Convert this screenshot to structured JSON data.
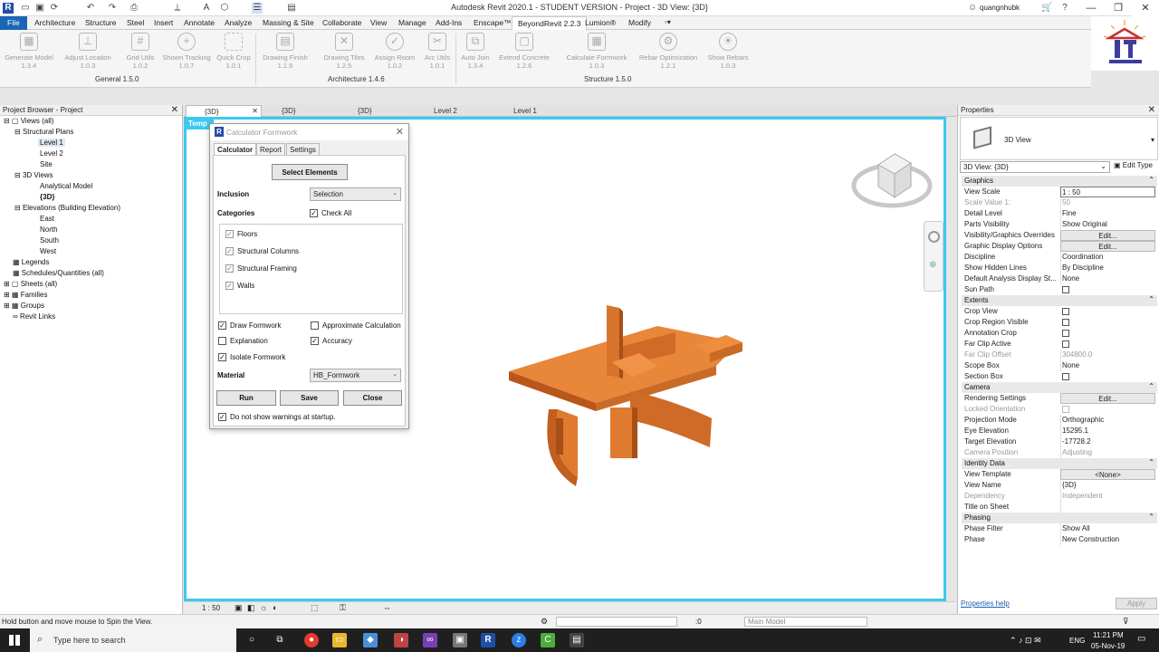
{
  "titlebar": {
    "title": "Autodesk Revit 2020.1 - STUDENT VERSION - Project - 3D View: {3D}",
    "user": "quangnhubk",
    "win_minimize": "—",
    "win_restore": "❐",
    "win_close": "✕"
  },
  "ribbon_tabs": [
    "File",
    "Architecture",
    "Structure",
    "Steel",
    "Insert",
    "Annotate",
    "Analyze",
    "Massing & Site",
    "Collaborate",
    "View",
    "Manage",
    "Add-Ins",
    "Enscape™",
    "BeyondRevit 2.2.3",
    "Lumion®",
    "Modify"
  ],
  "ribbon_tools": [
    {
      "label": "Generate Model",
      "version": "1.3.4"
    },
    {
      "label": "Adjust Location",
      "version": "1.0.3"
    },
    {
      "label": "Grid Utils",
      "version": "1.0.2"
    },
    {
      "label": "Shown Tracking",
      "version": "1.0.7"
    },
    {
      "label": "Quick Crop",
      "version": "1.0.1"
    },
    {
      "label": "Drawing Finish",
      "version": "1.1.9"
    },
    {
      "label": "Drawing Tiles",
      "version": "1.2.5"
    },
    {
      "label": "Assign Room",
      "version": "1.0.2"
    },
    {
      "label": "Arc Utils",
      "version": "1.0.1"
    },
    {
      "label": "Auto Join",
      "version": "1.3.4"
    },
    {
      "label": "Extend Concrete",
      "version": "1.2.6"
    },
    {
      "label": "Calculate Formwork",
      "version": "1.0.3"
    },
    {
      "label": "Rebar Optimization",
      "version": "1.2.1"
    },
    {
      "label": "Show Rebars",
      "version": "1.0.3"
    }
  ],
  "ribbon_groups": [
    "General 1.5.0",
    "Architecture 1.4.6",
    "Structure 1.5.0"
  ],
  "project_browser": {
    "title": "Project Browser - Project",
    "items": [
      {
        "label": "Views (all)",
        "level": 0
      },
      {
        "label": "Structural Plans",
        "level": 1
      },
      {
        "label": "Level 1",
        "level": 2,
        "selected": true
      },
      {
        "label": "Level 2",
        "level": 2
      },
      {
        "label": "Site",
        "level": 2
      },
      {
        "label": "3D Views",
        "level": 1
      },
      {
        "label": "Analytical Model",
        "level": 2
      },
      {
        "label": "{3D}",
        "level": 2,
        "bold": true
      },
      {
        "label": "Elevations (Building Elevation)",
        "level": 1
      },
      {
        "label": "East",
        "level": 2
      },
      {
        "label": "North",
        "level": 2
      },
      {
        "label": "South",
        "level": 2
      },
      {
        "label": "West",
        "level": 2
      },
      {
        "label": "Legends",
        "level": 0
      },
      {
        "label": "Schedules/Quantities (all)",
        "level": 0
      },
      {
        "label": "Sheets (all)",
        "level": 0
      },
      {
        "label": "Families",
        "level": 0
      },
      {
        "label": "Groups",
        "level": 0
      },
      {
        "label": "Revit Links",
        "level": 0
      }
    ]
  },
  "view_tabs": [
    "{3D}",
    "{3D}",
    "{3D}",
    "Level 2",
    "Level 1"
  ],
  "viewport": {
    "temp_label": "Temp"
  },
  "dialog": {
    "title": "Calculator Formwork",
    "tabs": [
      "Calculator",
      "Report",
      "Settings"
    ],
    "select_button": "Select Elements",
    "inclusion_label": "Inclusion",
    "inclusion_value": "Selection",
    "categories_label": "Categories",
    "check_all": "Check All",
    "categories": [
      "Floors",
      "Structural Columns",
      "Structural Framing",
      "Walls"
    ],
    "options": {
      "draw_formwork": "Draw Formwork",
      "approximate": "Approximate Calculation",
      "explanation": "Explanation",
      "accuracy": "Accuracy",
      "isolate": "Isolate Formwork"
    },
    "material_label": "Material",
    "material_value": "HB_Formwork",
    "run": "Run",
    "save": "Save",
    "close": "Close",
    "no_warnings": "Do not show warnings at startup."
  },
  "view_control": {
    "scale": "1 : 50"
  },
  "properties": {
    "title": "Properties",
    "type_name": "3D View",
    "selector": "3D View: {3D}",
    "edit_type": "Edit Type",
    "sections": [
      {
        "name": "Graphics",
        "rows": [
          {
            "k": "View Scale",
            "v": "1 : 50",
            "style": "boxed"
          },
          {
            "k": "Scale Value    1:",
            "v": "50",
            "style": "grey"
          },
          {
            "k": "Detail Level",
            "v": "Fine"
          },
          {
            "k": "Parts Visibility",
            "v": "Show Original"
          },
          {
            "k": "Visibility/Graphics Overrides",
            "v": "Edit...",
            "style": "button"
          },
          {
            "k": "Graphic Display Options",
            "v": "Edit...",
            "style": "button"
          },
          {
            "k": "Discipline",
            "v": "Coordination"
          },
          {
            "k": "Show Hidden Lines",
            "v": "By Discipline"
          },
          {
            "k": "Default Analysis Display St...",
            "v": "None"
          },
          {
            "k": "Sun Path",
            "v": "",
            "style": "check"
          }
        ]
      },
      {
        "name": "Extents",
        "rows": [
          {
            "k": "Crop View",
            "v": "",
            "style": "check"
          },
          {
            "k": "Crop Region Visible",
            "v": "",
            "style": "check"
          },
          {
            "k": "Annotation Crop",
            "v": "",
            "style": "check"
          },
          {
            "k": "Far Clip Active",
            "v": "",
            "style": "check"
          },
          {
            "k": "Far Clip Offset",
            "v": "304800.0",
            "style": "grey"
          },
          {
            "k": "Scope Box",
            "v": "None"
          },
          {
            "k": "Section Box",
            "v": "",
            "style": "check"
          }
        ]
      },
      {
        "name": "Camera",
        "rows": [
          {
            "k": "Rendering Settings",
            "v": "Edit...",
            "style": "button"
          },
          {
            "k": "Locked Orientation",
            "v": "",
            "style": "greycheck"
          },
          {
            "k": "Projection Mode",
            "v": "Orthographic"
          },
          {
            "k": "Eye Elevation",
            "v": "15295.1"
          },
          {
            "k": "Target Elevation",
            "v": "-17728.2"
          },
          {
            "k": "Camera Position",
            "v": "Adjusting",
            "style": "grey"
          }
        ]
      },
      {
        "name": "Identity Data",
        "rows": [
          {
            "k": "View Template",
            "v": "<None>",
            "style": "button"
          },
          {
            "k": "View Name",
            "v": "{3D}"
          },
          {
            "k": "Dependency",
            "v": "Independent",
            "style": "grey"
          },
          {
            "k": "Title on Sheet",
            "v": ""
          }
        ]
      },
      {
        "name": "Phasing",
        "rows": [
          {
            "k": "Phase Filter",
            "v": "Show All"
          },
          {
            "k": "Phase",
            "v": "New Construction"
          }
        ]
      }
    ],
    "help": "Properties help",
    "apply": "Apply"
  },
  "status": {
    "message": "Hold button and move mouse to Spin the View.",
    "count": ":0",
    "model": "Main Model"
  },
  "taskbar": {
    "search_placeholder": "Type here to search",
    "time": "11:21 PM",
    "date": "05-Nov-19",
    "lang": "ENG"
  },
  "colors": {
    "accent": "#3cc9ef",
    "file_tab": "#1a66b3",
    "model": "#e07a2e"
  }
}
